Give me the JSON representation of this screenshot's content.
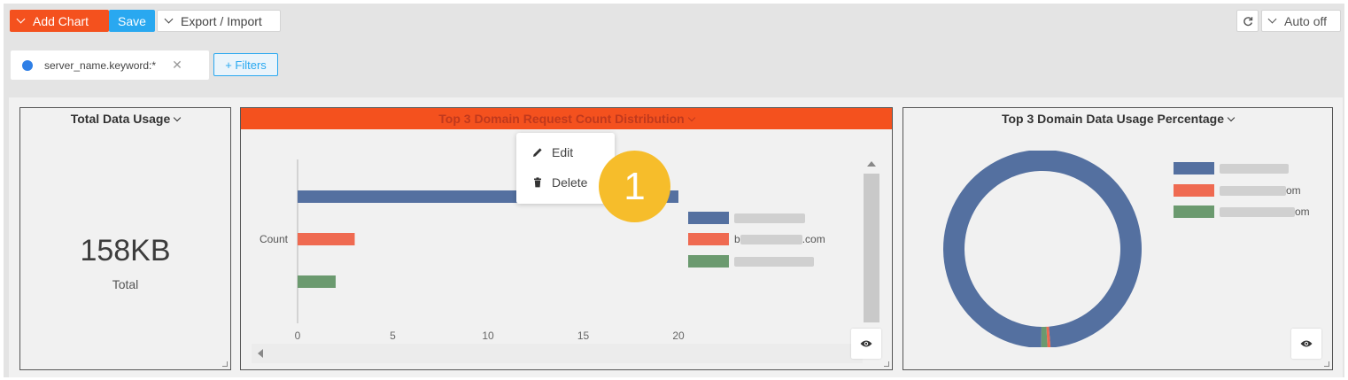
{
  "toolbar": {
    "add_chart_label": "Add Chart",
    "save_label": "Save",
    "export_import_label": "Export / Import",
    "refresh_icon": "refresh-icon",
    "auto_refresh_label": "Auto off"
  },
  "filters": {
    "active": [
      {
        "label": "server_name.keyword:*",
        "color": "#2f7fe6"
      }
    ],
    "add_filters_label": "+ Filters"
  },
  "panels": {
    "total_usage": {
      "title": "Total Data Usage",
      "value": "158KB",
      "value_label": "Total"
    },
    "request_count": {
      "title": "Top 3 Domain Request Count Distribution",
      "title_bar_color": "#f4511e",
      "legend": [
        {
          "color": "#5470a0",
          "label": "",
          "suffix": ""
        },
        {
          "color": "#ef6a51",
          "label": "b",
          "suffix": ".com"
        },
        {
          "color": "#6b9a6f",
          "label": "",
          "suffix": ""
        }
      ]
    },
    "usage_percentage": {
      "title": "Top 3 Domain Data Usage Percentage",
      "legend": [
        {
          "color": "#5470a0",
          "label": "",
          "suffix": ""
        },
        {
          "color": "#ef6a51",
          "label": "",
          "suffix": "om"
        },
        {
          "color": "#6b9a6f",
          "label": "",
          "suffix": "om"
        }
      ]
    }
  },
  "context_menu": {
    "edit_label": "Edit",
    "delete_label": "Delete"
  },
  "step_badge": "1",
  "chart_data": [
    {
      "type": "bar",
      "orientation": "horizontal",
      "title": "Top 3 Domain Request Count Distribution",
      "ylabel": "Count",
      "categories": [
        "Count"
      ],
      "series": [
        {
          "color": "#5470a0",
          "values": [
            20
          ]
        },
        {
          "color": "#ef6a51",
          "values": [
            3
          ]
        },
        {
          "color": "#6b9a6f",
          "values": [
            2
          ]
        }
      ],
      "x_ticks": [
        0,
        5,
        10,
        15,
        20
      ],
      "xlim": [
        0,
        25
      ],
      "grid": false,
      "legend_position": "right"
    },
    {
      "type": "pie",
      "subtype": "donut",
      "title": "Top 3 Domain Data Usage Percentage",
      "values": [
        98.5,
        0.5,
        1.0
      ],
      "colors": [
        "#5470a0",
        "#ef6a51",
        "#6b9a6f"
      ],
      "legend_position": "right"
    }
  ]
}
